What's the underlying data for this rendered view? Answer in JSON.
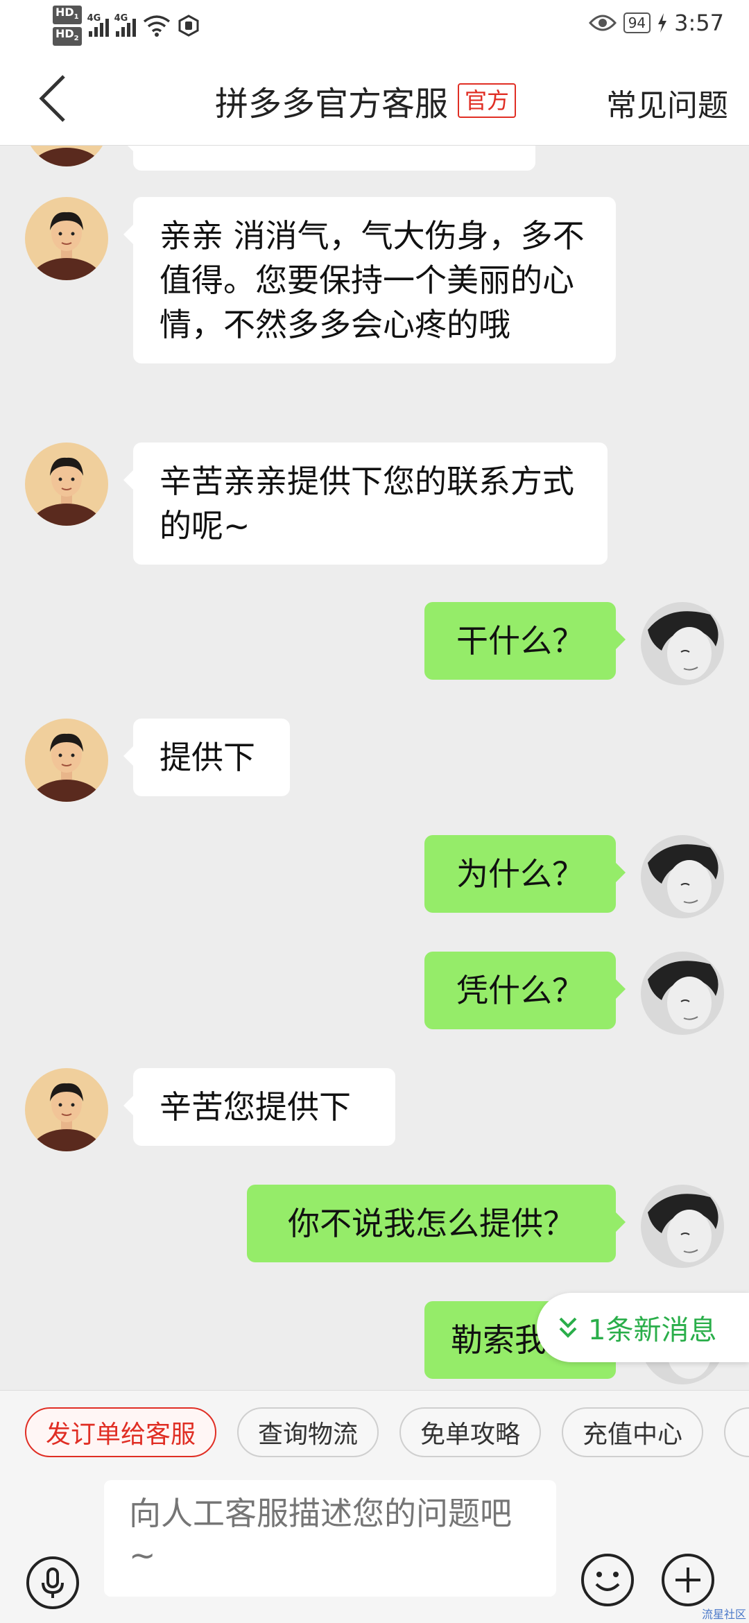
{
  "status_bar": {
    "sim1": "HD",
    "sim1_index": "1",
    "sim2": "HD",
    "sim2_index": "2",
    "net1": "4G",
    "net2": "4G",
    "battery": "94",
    "time": "3:57"
  },
  "header": {
    "title": "拼多多官方客服",
    "badge": "官方",
    "faq": "常见问题"
  },
  "messages": [
    {
      "side": "in",
      "text": "亲亲 消消气，气大伤身，多不值得。您要保持一个美丽的心情，不然多多会心疼的哦"
    },
    {
      "side": "in",
      "text": "辛苦亲亲提供下您的联系方式的呢~"
    },
    {
      "side": "out",
      "text": "干什么？"
    },
    {
      "side": "in",
      "text": "提供下"
    },
    {
      "side": "out",
      "text": "为什么？"
    },
    {
      "side": "out",
      "text": "凭什么？"
    },
    {
      "side": "in",
      "text": "辛苦您提供下"
    },
    {
      "side": "out",
      "text": "你不说我怎么提供？"
    },
    {
      "side": "out",
      "text": "勒索我"
    }
  ],
  "new_message": "1条新消息",
  "quick_actions": [
    "发订单给客服",
    "查询物流",
    "免单攻略",
    "充值中心"
  ],
  "input": {
    "placeholder": "向人工客服描述您的问题吧~"
  },
  "icons": {
    "back": "chevron-left-icon",
    "mic": "microphone-icon",
    "emoji": "smile-icon",
    "plus": "plus-icon"
  },
  "colors": {
    "outgoing_bubble": "#95ec69",
    "incoming_bubble": "#ffffff",
    "brand_red": "#e02e24",
    "new_msg_green": "#2aae4a",
    "chat_background": "#ededed"
  },
  "watermark": "流星社区"
}
